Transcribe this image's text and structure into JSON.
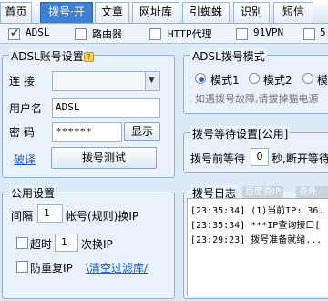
{
  "tabs": [
    "首页",
    "拨号·开",
    "文章",
    "网址库",
    "引蜘蛛",
    "识别",
    "短信"
  ],
  "subtabs": [
    {
      "label": "ADSL",
      "checked": true
    },
    {
      "label": "路由器",
      "checked": false
    },
    {
      "label": "HTTP代理",
      "checked": false
    },
    {
      "label": "91VPN",
      "checked": false
    },
    {
      "label": "5",
      "checked": false
    }
  ],
  "adsl_settings": {
    "title": "ADSL账号设置",
    "connect_label": "连 接",
    "user_label": "用户名",
    "user_value": "ADSL",
    "password_label": "密 码",
    "password_value": "******",
    "show_button": "显示",
    "dial_button": "拨号测试",
    "link": "破译"
  },
  "dial_mode": {
    "title": "ADSL拨号模式",
    "modes": [
      "模式1",
      "模式2",
      "模"
    ],
    "selected": 0,
    "note": "如遇拨号故障,请拔掉猫电源"
  },
  "wait": {
    "title": "拨号等待设置[公用]",
    "label_before": "拨号前等待",
    "value": "0",
    "label_after": "秒,断开等待"
  },
  "public": {
    "title": "公用设置",
    "interval_label": "间隔",
    "interval_value": "1",
    "interval_suffix": "帐号(规则)换IP",
    "timeout_label": "超时",
    "timeout_value": "1",
    "timeout_suffix": "次换IP",
    "antirepeat_label": "防重复IP",
    "clear_filter": "\\清空过滤库/"
  },
  "log": {
    "title": "拨号日志",
    "btn1": "百度查IP",
    "btn2": "查外网",
    "lines": [
      "[23:35:34] (1)当前IP: 36.",
      "[23:35:34] ***IP查询接口[",
      "[23:29:23] 拨号准备就绪..."
    ]
  }
}
